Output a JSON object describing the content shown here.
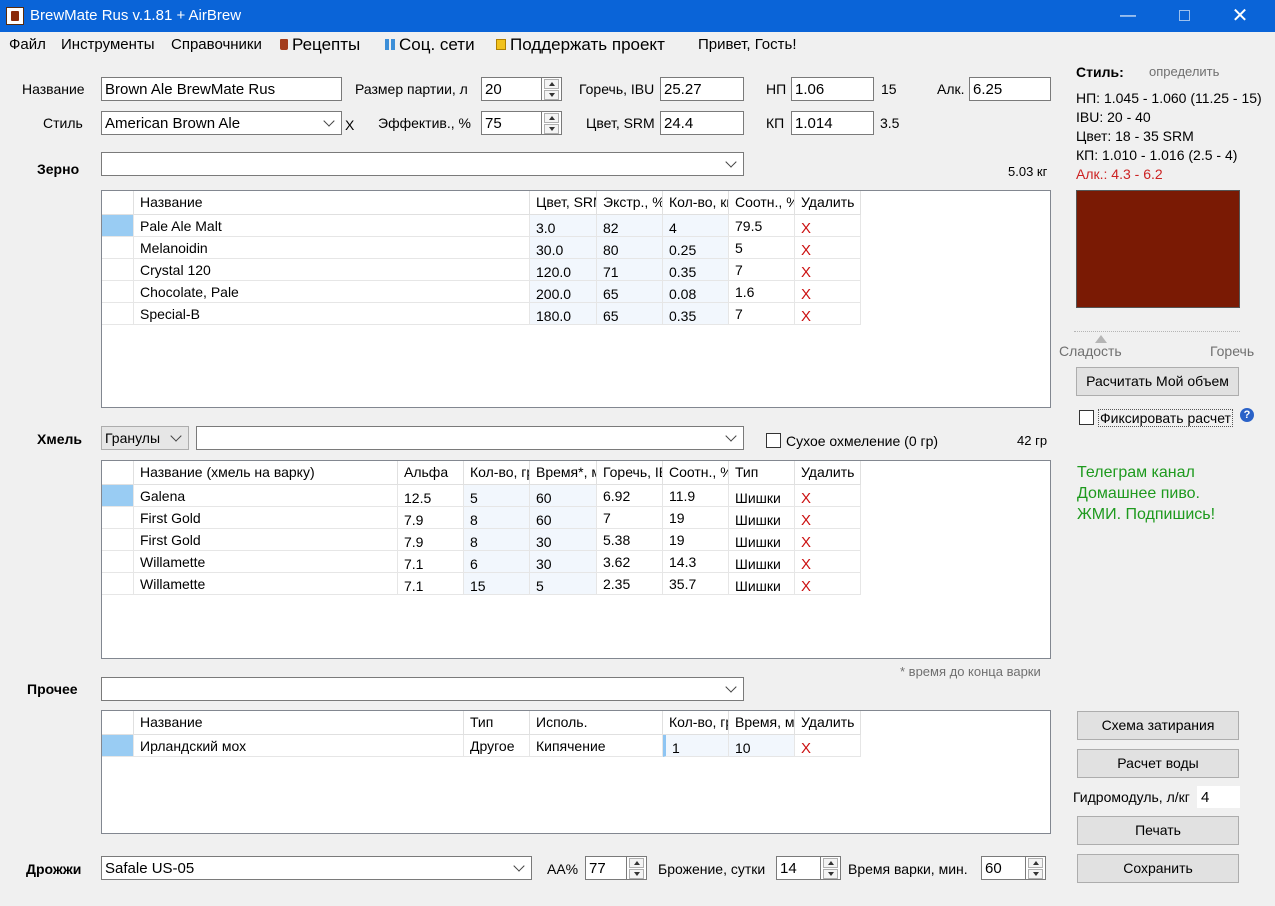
{
  "window": {
    "title": "BrewMate Rus v.1.81 + AirBrew",
    "minimize": "—",
    "close": "✕"
  },
  "menu": {
    "file": "Файл",
    "tools": "Инструменты",
    "references": "Справочники",
    "recipes": "Рецепты",
    "social": "Соц. сети",
    "support": "Поддержать проект",
    "greeting": "Привет, Гость!"
  },
  "recipe": {
    "name_label": "Название",
    "name_value": "Brown Ale BrewMate Rus",
    "style_label": "Стиль",
    "style_value": "American Brown Ale",
    "style_clear": "X",
    "batch_label": "Размер партии, л",
    "batch_value": "20",
    "eff_label": "Эффектив., %",
    "eff_value": "75",
    "ibu_label": "Горечь, IBU",
    "ibu_value": "25.27",
    "srm_label": "Цвет, SRM",
    "srm_value": "24.4",
    "og_label": "НП",
    "og_value": "1.06",
    "og_plato": "15",
    "fg_label": "КП",
    "fg_value": "1.014",
    "fg_plato": "3.5",
    "abv_label": "Алк.",
    "abv_value": "6.25"
  },
  "grain": {
    "label": "Зерно",
    "total": "5.03 кг",
    "columns": [
      "Название",
      "Цвет, SRM",
      "Экстр., %",
      "Кол-во, кг",
      "Соотн., %",
      "Удалить"
    ],
    "rows": [
      {
        "name": "Pale Ale Malt",
        "color": "3.0",
        "extract": "82",
        "amount": "4",
        "ratio": "79.5",
        "del": "X"
      },
      {
        "name": "Melanoidin",
        "color": "30.0",
        "extract": "80",
        "amount": "0.25",
        "ratio": "5",
        "del": "X"
      },
      {
        "name": "Crystal 120",
        "color": "120.0",
        "extract": "71",
        "amount": "0.35",
        "ratio": "7",
        "del": "X"
      },
      {
        "name": "Chocolate, Pale",
        "color": "200.0",
        "extract": "65",
        "amount": "0.08",
        "ratio": "1.6",
        "del": "X"
      },
      {
        "name": "Special-B",
        "color": "180.0",
        "extract": "65",
        "amount": "0.35",
        "ratio": "7",
        "del": "X"
      }
    ]
  },
  "hops": {
    "label": "Хмель",
    "form_value": "Гранулы",
    "dry_hop_label": "Сухое охмеление (0 гр)",
    "total": "42 гр",
    "columns": [
      "Название (хмель на варку)",
      "Альфа",
      "Кол-во, гр",
      "Время*, мин",
      "Горечь, IBU",
      "Соотн., %",
      "Тип",
      "Удалить"
    ],
    "rows": [
      {
        "name": "Galena",
        "alpha": "12.5",
        "amount": "5",
        "time": "60",
        "ibu": "6.92",
        "ratio": "11.9",
        "type": "Шишки",
        "del": "X"
      },
      {
        "name": "First Gold",
        "alpha": "7.9",
        "amount": "8",
        "time": "60",
        "ibu": "7",
        "ratio": "19",
        "type": "Шишки",
        "del": "X"
      },
      {
        "name": "First Gold",
        "alpha": "7.9",
        "amount": "8",
        "time": "30",
        "ibu": "5.38",
        "ratio": "19",
        "type": "Шишки",
        "del": "X"
      },
      {
        "name": "Willamette",
        "alpha": "7.1",
        "amount": "6",
        "time": "30",
        "ibu": "3.62",
        "ratio": "14.3",
        "type": "Шишки",
        "del": "X"
      },
      {
        "name": "Willamette",
        "alpha": "7.1",
        "amount": "15",
        "time": "5",
        "ibu": "2.35",
        "ratio": "35.7",
        "type": "Шишки",
        "del": "X"
      }
    ],
    "footnote": "* время до конца варки"
  },
  "other": {
    "label": "Прочее",
    "columns": [
      "Название",
      "Тип",
      "Исполь.",
      "Кол-во, гр",
      "Время, мин",
      "Удалить"
    ],
    "rows": [
      {
        "name": "Ирландский мох",
        "type": "Другое",
        "use": "Кипячение",
        "amount": "1",
        "time": "10",
        "del": "X"
      }
    ]
  },
  "yeast": {
    "label": "Дрожжи",
    "value": "Safale US-05",
    "aa_label": "AA%",
    "aa_value": "77",
    "ferm_label": "Брожение, сутки",
    "ferm_value": "14",
    "boil_label": "Время варки, мин.",
    "boil_value": "60"
  },
  "style_panel": {
    "title": "Стиль:",
    "detect": "определить",
    "og": "НП:   1.045 - 1.060 (11.25 - 15)",
    "ibu": "IBU:  20 - 40",
    "color": "Цвет: 18 - 35 SRM",
    "fg": "КП:    1.010 - 1.016 (2.5 - 4)",
    "abv": "Алк.: 4.3 - 6.2",
    "swatch_color": "#7a1a04",
    "sweet_label": "Сладость",
    "bitter_label": "Горечь",
    "balance_fraction": 0.16
  },
  "sidebar": {
    "calc_volume": "Расчитать Мой объем",
    "fix_calc": "Фиксировать расчет",
    "promo_1": "Телеграм канал",
    "promo_2": "Домашнее пиво.",
    "promo_3": "ЖМИ. Подпишись!",
    "mash": "Схема затирания",
    "water": "Расчет воды",
    "hydro_label": "Гидромодуль, л/кг",
    "hydro_value": "4",
    "print": "Печать",
    "save": "Сохранить"
  }
}
